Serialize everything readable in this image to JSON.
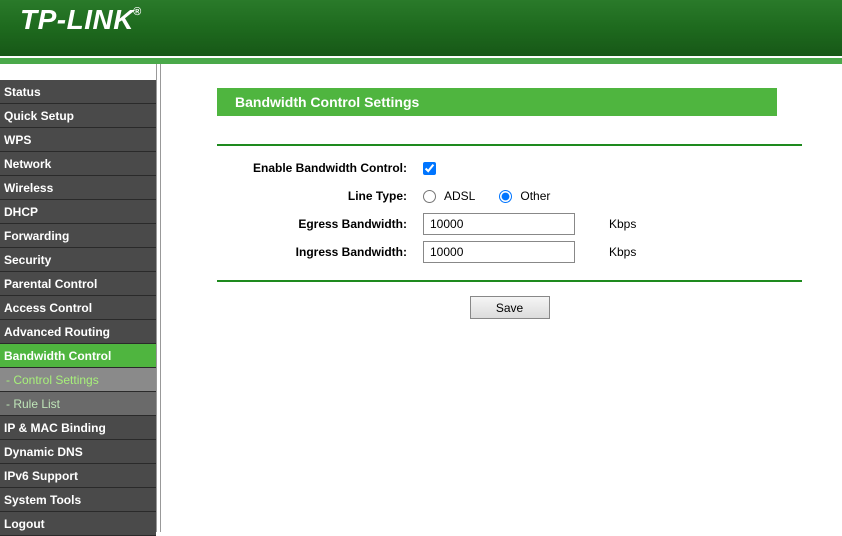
{
  "brand": "TP-LINK",
  "brand_reg": "®",
  "sidebar": {
    "items": [
      {
        "label": "Status",
        "active": false
      },
      {
        "label": "Quick Setup",
        "active": false
      },
      {
        "label": "WPS",
        "active": false
      },
      {
        "label": "Network",
        "active": false
      },
      {
        "label": "Wireless",
        "active": false
      },
      {
        "label": "DHCP",
        "active": false
      },
      {
        "label": "Forwarding",
        "active": false
      },
      {
        "label": "Security",
        "active": false
      },
      {
        "label": "Parental Control",
        "active": false
      },
      {
        "label": "Access Control",
        "active": false
      },
      {
        "label": "Advanced Routing",
        "active": false
      },
      {
        "label": "Bandwidth Control",
        "active": true
      },
      {
        "label": "- Control Settings",
        "active": true,
        "sub": true
      },
      {
        "label": "- Rule List",
        "active": false,
        "sub": true
      },
      {
        "label": "IP & MAC Binding",
        "active": false
      },
      {
        "label": "Dynamic DNS",
        "active": false
      },
      {
        "label": "IPv6 Support",
        "active": false
      },
      {
        "label": "System Tools",
        "active": false
      },
      {
        "label": "Logout",
        "active": false
      }
    ]
  },
  "panel": {
    "title": "Bandwidth Control Settings",
    "enable_label": "Enable Bandwidth Control:",
    "enable_checked": true,
    "line_type_label": "Line Type:",
    "line_type_options": {
      "adsl": "ADSL",
      "other": "Other"
    },
    "line_type_selected": "other",
    "egress_label": "Egress Bandwidth:",
    "egress_value": "10000",
    "ingress_label": "Ingress Bandwidth:",
    "ingress_value": "10000",
    "unit": "Kbps",
    "save_label": "Save"
  }
}
